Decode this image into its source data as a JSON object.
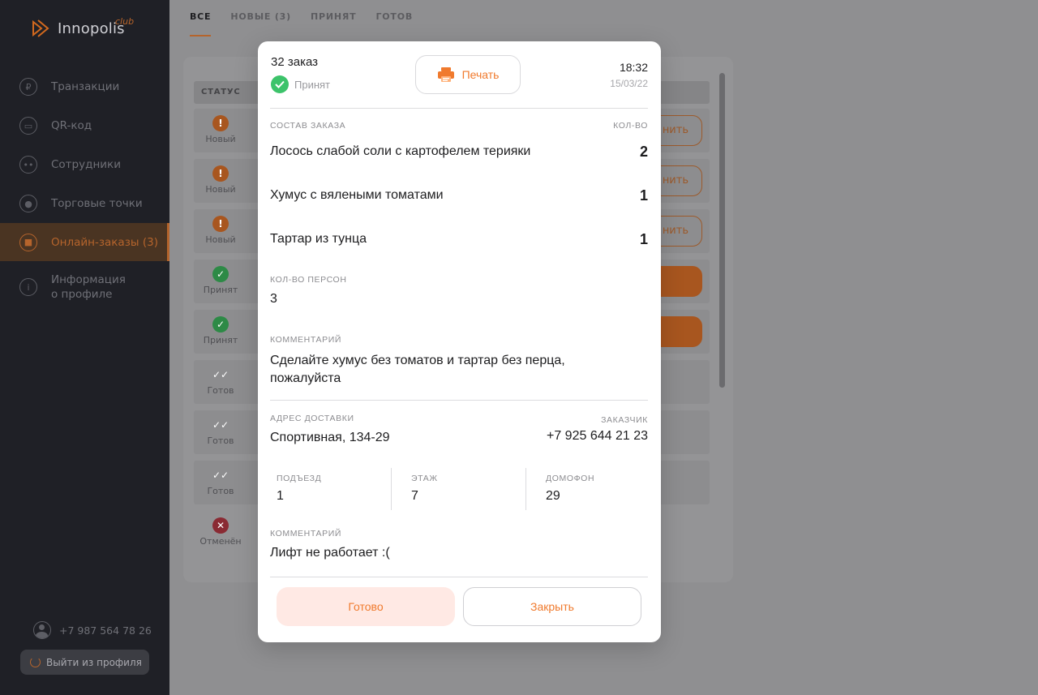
{
  "app": {
    "logo_text": "Innopolis",
    "logo_sup": "club",
    "accent_color": "#f07a2d"
  },
  "sidebar": {
    "items": [
      {
        "label": "Транзакции",
        "icon": "ruble-icon"
      },
      {
        "label": "QR-код",
        "icon": "qr-icon"
      },
      {
        "label": "Сотрудники",
        "icon": "users-icon"
      },
      {
        "label": "Торговые точки",
        "icon": "location-icon"
      },
      {
        "label": "Онлайн-заказы (3)",
        "icon": "bag-icon",
        "active": true
      },
      {
        "label_line1": "Информация",
        "label_line2": "о профиле",
        "icon": "info-icon"
      }
    ],
    "phone": "+7 987 564 78 26",
    "logout_label": "Выйти из профиля"
  },
  "main": {
    "tabs": [
      "ВСЕ",
      "НОВЫЕ (3)",
      "ПРИНЯТ",
      "ГОТОВ"
    ],
    "active_tab": "ВСЕ",
    "table_header": "СТАТУС",
    "rows": [
      {
        "status": "Новый",
        "kind": "new",
        "action": "нить"
      },
      {
        "status": "Новый",
        "kind": "new",
        "action": "нить"
      },
      {
        "status": "Новый",
        "kind": "new",
        "action": "нить"
      },
      {
        "status": "Принят",
        "kind": "accepted",
        "action": ""
      },
      {
        "status": "Принят",
        "kind": "accepted",
        "action": ""
      },
      {
        "status": "Готов",
        "kind": "done",
        "action": ""
      },
      {
        "status": "Готов",
        "kind": "done",
        "action": ""
      },
      {
        "status": "Готов",
        "kind": "done",
        "action": ""
      },
      {
        "status": "Отменён",
        "kind": "cancel",
        "action": ""
      }
    ]
  },
  "modal": {
    "order_title": "32 заказ",
    "status": "Принят",
    "print_label": "Печать",
    "time": "18:32",
    "date": "15/03/22",
    "composition_caption": "СОСТАВ ЗАКАЗА",
    "qty_caption": "КОЛ-ВО",
    "items": [
      {
        "name": "Лосось слабой соли с картофелем терияки",
        "qty": "2"
      },
      {
        "name": "Хумус с вялеными томатами",
        "qty": "1"
      },
      {
        "name": "Тартар из тунца",
        "qty": "1"
      }
    ],
    "persons_caption": "КОЛ-ВО ПЕРСОН",
    "persons": "3",
    "comment_caption": "КОММЕНТАРИЙ",
    "comment": "Сделайте хумус без томатов и тартар без перца, пожалуйста",
    "address_caption": "АДРЕС ДОСТАВКИ",
    "address": "Спортивная, 134-29",
    "customer_caption": "ЗАКАЗЧИК",
    "customer_phone": "+7 925 644 21 23",
    "entrance_caption": "ПОДЪЕЗД",
    "entrance": "1",
    "floor_caption": "ЭТАЖ",
    "floor": "7",
    "intercom_caption": "ДОМОФОН",
    "intercom": "29",
    "delivery_comment_caption": "КОММЕНТАРИЙ",
    "delivery_comment": "Лифт не работает :(",
    "ready_label": "Готово",
    "close_label": "Закрыть"
  }
}
